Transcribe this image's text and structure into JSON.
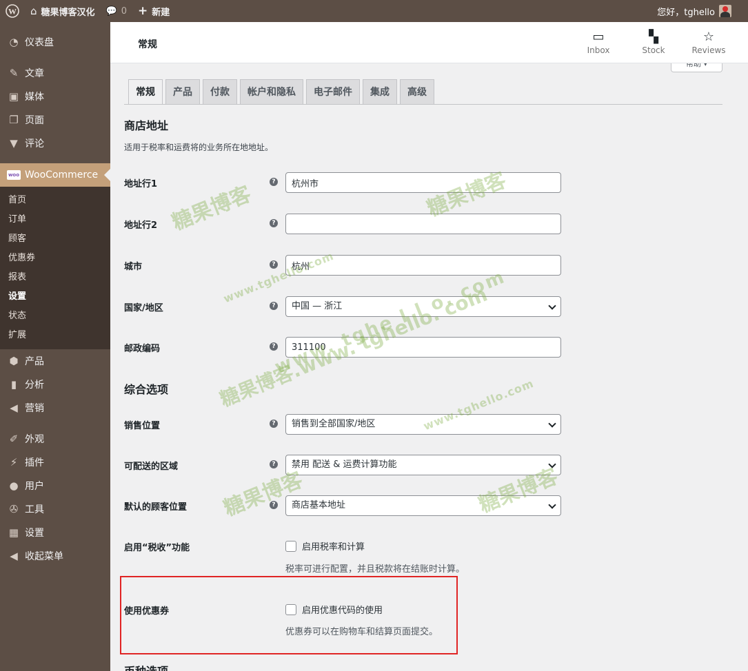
{
  "adminbar": {
    "site_name": "糖果博客汉化",
    "comments_count": "0",
    "new_label": "新建",
    "greeting": "您好，tghello"
  },
  "sidebar": {
    "items_top": [
      {
        "label": "仪表盘",
        "icon": "dashboard-icon"
      },
      {
        "label": "文章",
        "icon": "pin-icon"
      },
      {
        "label": "媒体",
        "icon": "media-icon"
      },
      {
        "label": "页面",
        "icon": "page-icon"
      },
      {
        "label": "评论",
        "icon": "comment-icon"
      }
    ],
    "woocommerce": {
      "label": "WooCommerce",
      "badge": "woo",
      "submenu": [
        "首页",
        "订单",
        "顾客",
        "优惠券",
        "报表",
        "设置",
        "状态",
        "扩展"
      ],
      "active_submenu": "设置"
    },
    "items_mid": [
      {
        "label": "产品",
        "icon": "product-icon"
      },
      {
        "label": "分析",
        "icon": "analytics-icon"
      },
      {
        "label": "营销",
        "icon": "megaphone-icon"
      }
    ],
    "items_bottom": [
      {
        "label": "外观",
        "icon": "brush-icon"
      },
      {
        "label": "插件",
        "icon": "plugin-icon"
      },
      {
        "label": "用户",
        "icon": "user-icon"
      },
      {
        "label": "工具",
        "icon": "wrench-icon"
      },
      {
        "label": "设置",
        "icon": "settings-icon"
      },
      {
        "label": "收起菜单",
        "icon": "collapse-icon"
      }
    ]
  },
  "header": {
    "title": "常规",
    "buttons": [
      {
        "label": "Inbox",
        "icon": "inbox-icon"
      },
      {
        "label": "Stock",
        "icon": "stock-icon"
      },
      {
        "label": "Reviews",
        "icon": "star-icon"
      }
    ],
    "help_label": "帮助"
  },
  "tabs": [
    "常规",
    "产品",
    "付款",
    "帐户和隐私",
    "电子邮件",
    "集成",
    "高级"
  ],
  "active_tab": "常规",
  "store_address": {
    "heading": "商店地址",
    "description": "适用于税率和运费将的业务所在地地址。",
    "address1_label": "地址行1",
    "address1_value": "杭州市",
    "address2_label": "地址行2",
    "address2_value": "",
    "city_label": "城市",
    "city_value": "杭州",
    "country_label": "国家/地区",
    "country_value": "中国 — 浙江",
    "postcode_label": "邮政编码",
    "postcode_value": "311100"
  },
  "general_options": {
    "heading": "综合选项",
    "selling_label": "销售位置",
    "selling_value": "销售到全部国家/地区",
    "shipping_label": "可配送的区域",
    "shipping_value": "禁用 配送 & 运费计算功能",
    "customer_label": "默认的顾客位置",
    "customer_value": "商店基本地址",
    "taxes_label": "启用“税收”功能",
    "taxes_checkbox": "启用税率和计算",
    "taxes_desc": "税率可进行配置，并且税款将在结账时计算。",
    "coupons_label": "使用优惠券",
    "coupons_checkbox": "启用优惠代码的使用",
    "coupons_desc": "优惠券可以在购物车和结算页面提交。"
  },
  "next_heading": "币种选项",
  "help_symbol": "?",
  "watermark": {
    "brand": "糖果博客",
    "url_small": "www.tghello.com",
    "url_spaced": "www. tghe l l o. com",
    "combo": "糖果博客.www. tghello. com"
  }
}
